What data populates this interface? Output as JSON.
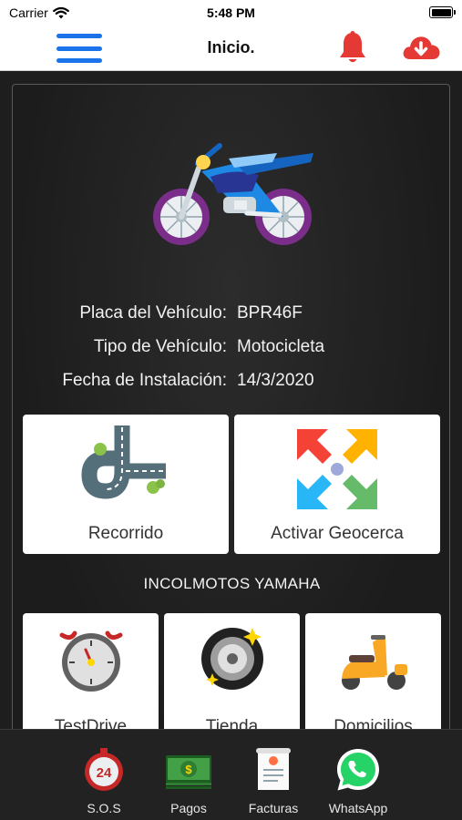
{
  "status_bar": {
    "carrier": "Carrier",
    "time": "5:48 PM",
    "battery_level": 1.0
  },
  "nav": {
    "title": "Inicio."
  },
  "vehicle": {
    "plate_label": "Placa del Vehículo:",
    "plate_value": "BPR46F",
    "type_label": "Tipo de Vehículo:",
    "type_value": "Motocicleta",
    "install_label": "Fecha de Instalación:",
    "install_value": "14/3/2020"
  },
  "actions": {
    "route_label": "Recorrido",
    "geofence_label": "Activar Geocerca"
  },
  "dealer": {
    "title": "INCOLMOTOS YAMAHA",
    "items": [
      {
        "label": "TestDrive",
        "icon": "speedometer-icon"
      },
      {
        "label": "Tienda",
        "icon": "tire-icon"
      },
      {
        "label": "Domicilios",
        "icon": "scooter-icon"
      }
    ]
  },
  "tabs": [
    {
      "label": "S.O.S",
      "icon": "sos-24-icon"
    },
    {
      "label": "Pagos",
      "icon": "money-icon"
    },
    {
      "label": "Facturas",
      "icon": "invoice-icon"
    },
    {
      "label": "WhatsApp",
      "icon": "whatsapp-icon"
    }
  ],
  "colors": {
    "accent_blue": "#1a73e8",
    "alert_red": "#e53935",
    "whatsapp_green": "#25d366",
    "background_dark": "#1e1e1e"
  }
}
